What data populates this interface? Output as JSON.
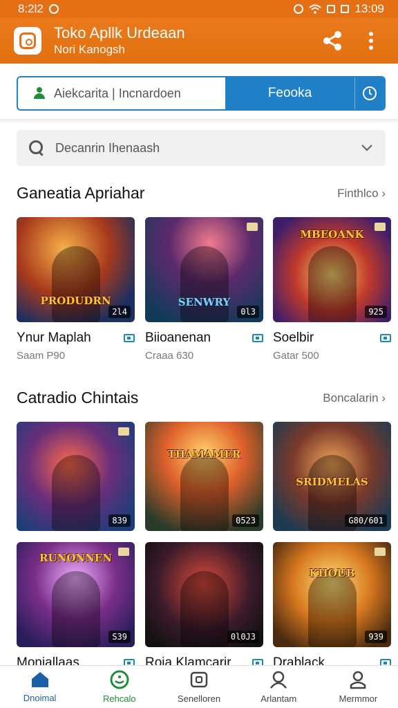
{
  "status_bar": {
    "time": "8:2l2",
    "right_time": "13:09"
  },
  "app_bar": {
    "title": "Toko Apllk Urdeaan",
    "subtitle": "Nori Kanogsh"
  },
  "top_tabs": {
    "left_text": "Aiekcarita | Incnardoen",
    "right_label": "Feooka"
  },
  "search": {
    "placeholder": "Decanrin Ihenaash"
  },
  "sections": [
    {
      "title": "Ganeatia Apriahar",
      "more": "Finthlco",
      "cards": [
        {
          "name": "Ynur Maplah",
          "sub": "Saam P90",
          "badge": "2l4",
          "logo": "PRODUDRN"
        },
        {
          "name": "Biioanenan",
          "sub": "Craaa 630",
          "badge": "0l3",
          "logo": "SENWRY"
        },
        {
          "name": "Soelbir",
          "sub": "Gatar 500",
          "badge": "925",
          "logo": "MBEOANK"
        }
      ]
    },
    {
      "title": "Catradio Chintais",
      "more": "Boncalarin",
      "cards": [
        {
          "name": "",
          "sub": "",
          "badge": "839",
          "logo": ""
        },
        {
          "name": "",
          "sub": "",
          "badge": "0523",
          "logo": "THAMAMER"
        },
        {
          "name": "",
          "sub": "",
          "badge": "G80/601",
          "logo": "SRIDMELAS"
        },
        {
          "name": "Moniallaas",
          "sub": "",
          "badge": "S39",
          "logo": "RUNONNEN"
        },
        {
          "name": "Roja Klamcarir",
          "sub": "",
          "badge": "0l0J3",
          "logo": ""
        },
        {
          "name": "Drablack",
          "sub": "",
          "badge": "939",
          "logo": "KHOUB"
        }
      ]
    }
  ],
  "bottom_nav": [
    {
      "label": "Dnoimal",
      "icon": "home-icon"
    },
    {
      "label": "Rehcalo",
      "icon": "smile-icon"
    },
    {
      "label": "Senelloren",
      "icon": "camera-icon"
    },
    {
      "label": "Arlantam",
      "icon": "person-icon"
    },
    {
      "label": "Mermmor",
      "icon": "profile-icon"
    }
  ],
  "colors": {
    "primary": "#e46f15",
    "accent": "#1f7fc7",
    "nav_active": "#1c5fa8"
  }
}
